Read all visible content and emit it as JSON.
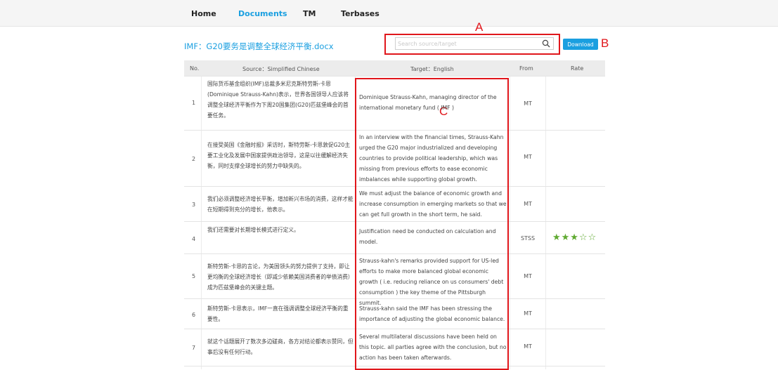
{
  "nav": {
    "items": [
      {
        "label": "Home",
        "active": false
      },
      {
        "label": "Documents",
        "active": true
      },
      {
        "label": "TM",
        "active": false
      },
      {
        "label": "Terbases",
        "active": false
      }
    ]
  },
  "document": {
    "filename": "IMF：G20要务是调整全球经济平衡.docx"
  },
  "search": {
    "placeholder": "Search source/target",
    "icon": "search-icon"
  },
  "download": {
    "label": "Download"
  },
  "annotations": {
    "a": "A",
    "b": "B",
    "c": "C",
    "color": "#e0161b"
  },
  "table": {
    "headers": {
      "no": "No.",
      "source": "Source：Simplified Chinese",
      "target": "Target：English",
      "from": "From",
      "rate": "Rate"
    },
    "rows": [
      {
        "no": "1",
        "source": "国际货币基金组织(IMF)总裁多米尼克斯特劳斯-卡恩(Dominique Strauss-Kahn)表示，世界各国领导人应该将调整全球经济平衡作为下周20国集团(G20)匹兹堡峰会的首要任务。",
        "target": "Dominique Strauss-Kahn, managing director of the international monetary fund ( IMF )",
        "from": "MT",
        "rate": ""
      },
      {
        "no": "2",
        "source": "在接受英国《金融时报》采访时，斯特劳斯-卡恩敦促G20主要工业化及发展中国家提供政治领导，这是以往缓解经济失衡，同时支撑全球增长的努力中缺失的。",
        "target": "In an interview with the financial times, Strauss-Kahn urged the G20 major industrialized and developing countries to provide political leadership, which was missing from previous efforts to ease economic imbalances while supporting global growth.",
        "from": "MT",
        "rate": ""
      },
      {
        "no": "3",
        "source": "我们必须调整经济增长平衡，增加新兴市场的消费，这样才能在短期得到充分的增长，他表示。",
        "target": "We must adjust the balance of economic growth and increase consumption in emerging markets so that we can get full growth in the short term, he said.",
        "from": "MT",
        "rate": ""
      },
      {
        "no": "4",
        "source": "我们还需要对长期增长模式进行定义。",
        "target": "Justification need be conducted on calculation and model.",
        "from": "STSS",
        "rate": "★★★☆☆",
        "rating_value": 3
      },
      {
        "no": "5",
        "source": "斯特劳斯-卡恩的言论，为美国领头的努力提供了支持，即让更均衡的全球经济增长（即减少依赖美国消费者的举债消费）成为匹兹堡峰会的关键主题。",
        "target": "Strauss-kahn's remarks provided support for US-led efforts to make more balanced global economic growth ( i.e. reducing reliance on us consumers' debt consumption ) the key theme of the Pittsburgh summit.",
        "from": "MT",
        "rate": ""
      },
      {
        "no": "6",
        "source": "斯特劳斯-卡恩表示，IMF一直在强调调整全球经济平衡的重要性。",
        "target": "Strauss-kahn said the IMF has been stressing the importance of adjusting the global economic balance.",
        "from": "MT",
        "rate": ""
      },
      {
        "no": "7",
        "source": "就这个话题展开了数次多边磋商，各方对结论都表示赞同，但事后没有任何行动。",
        "target": "Several multilateral discussions have been held on this topic. all parties agree with the conclusion, but no action has been taken afterwards.",
        "from": "MT",
        "rate": ""
      }
    ]
  }
}
